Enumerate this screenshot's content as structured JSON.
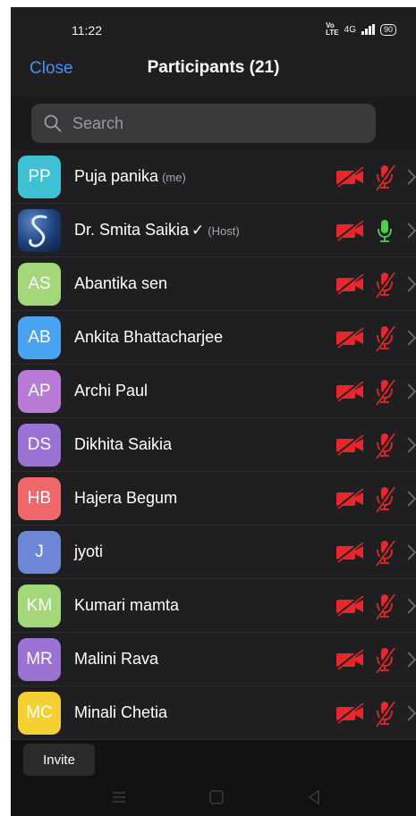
{
  "status_bar": {
    "time": "11:22",
    "volte": "Vo\nLTE",
    "network": "4G",
    "battery": "90"
  },
  "header": {
    "close_label": "Close",
    "title": "Participants (21)"
  },
  "search": {
    "placeholder": "Search"
  },
  "participants": [
    {
      "initials": "PP",
      "name": "Puja panika",
      "tag": "(me)",
      "avatar_color": "#3ec1d3",
      "video": "off",
      "mic": "muted"
    },
    {
      "initials": "",
      "name": "Dr. Smita Saikia",
      "check": "✓",
      "tag": "(Host)",
      "avatar_color": "#1d3f7a",
      "video": "off",
      "mic": "on"
    },
    {
      "initials": "AS",
      "name": "Abantika sen",
      "avatar_color": "#a3d77a",
      "video": "off",
      "mic": "muted"
    },
    {
      "initials": "AB",
      "name": "Ankita Bhattacharjee",
      "avatar_color": "#4aa3f0",
      "video": "off",
      "mic": "muted"
    },
    {
      "initials": "AP",
      "name": "Archi Paul",
      "avatar_color": "#b87ad4",
      "video": "off",
      "mic": "muted"
    },
    {
      "initials": "DS",
      "name": "Dikhita Saikia",
      "avatar_color": "#9b72d4",
      "video": "off",
      "mic": "muted"
    },
    {
      "initials": "HB",
      "name": "Hajera Begum",
      "avatar_color": "#f0686a",
      "video": "off",
      "mic": "muted"
    },
    {
      "initials": "J",
      "name": "jyoti",
      "avatar_color": "#6e86d6",
      "video": "off",
      "mic": "muted"
    },
    {
      "initials": "KM",
      "name": "Kumari mamta",
      "avatar_color": "#a3d77a",
      "video": "off",
      "mic": "muted"
    },
    {
      "initials": "MR",
      "name": "Malini Rava",
      "avatar_color": "#9b72d4",
      "video": "off",
      "mic": "muted"
    },
    {
      "initials": "MC",
      "name": "Minali Chetia",
      "avatar_color": "#f5d033",
      "video": "off",
      "mic": "muted"
    }
  ],
  "footer": {
    "invite_label": "Invite"
  },
  "colors": {
    "muted_red": "#e8262b",
    "mic_on_green": "#4bd14b",
    "accent_blue": "#4a8ff0"
  }
}
